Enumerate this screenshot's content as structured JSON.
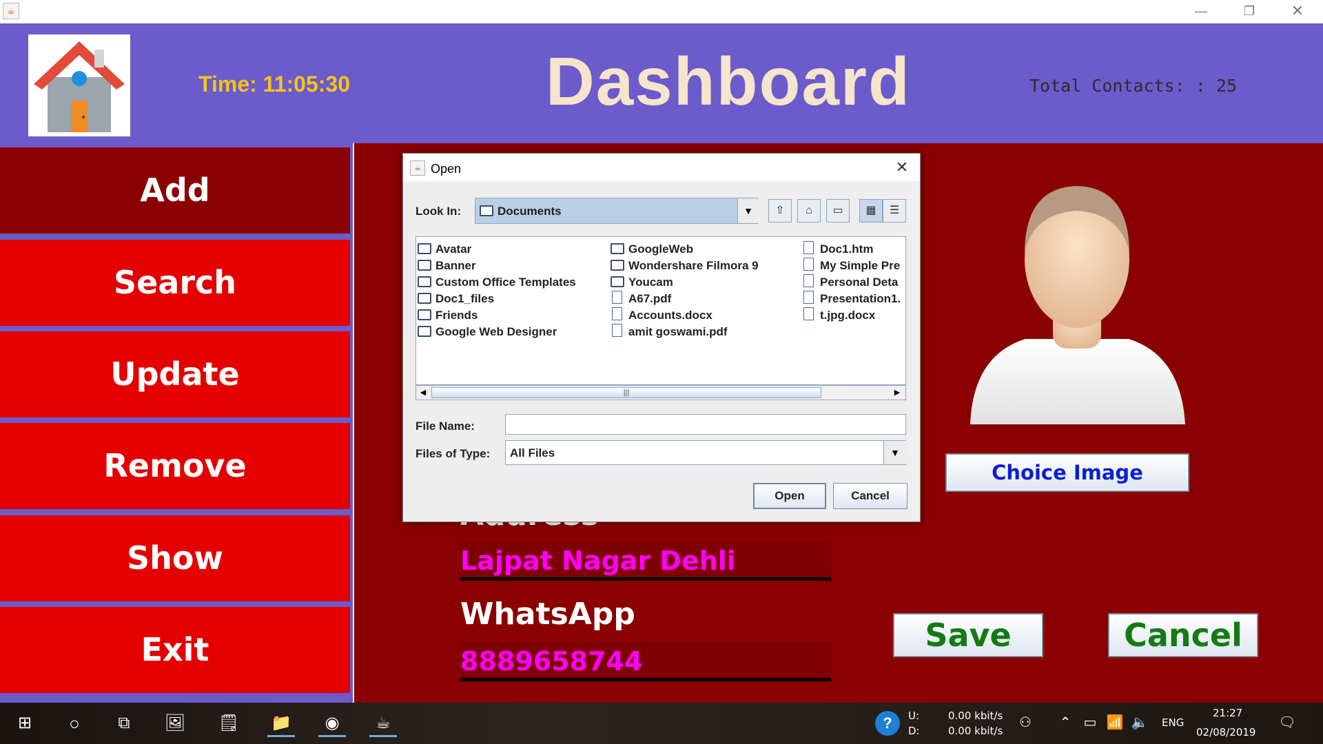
{
  "window": {
    "minimize_icon": "minimize-icon",
    "restore_icon": "restore-icon",
    "close_icon": "close-icon"
  },
  "header": {
    "time_label": "Time:  11:05:30",
    "title": "Dashboard",
    "total_contacts": "Total Contacts: : 25"
  },
  "sidebar": {
    "items": [
      {
        "label": "Add"
      },
      {
        "label": "Search"
      },
      {
        "label": "Update"
      },
      {
        "label": "Remove"
      },
      {
        "label": "Show"
      },
      {
        "label": "Exit"
      }
    ]
  },
  "form": {
    "address_label": "Address",
    "address_value": "Lajpat Nagar Dehli",
    "whatsapp_label": "WhatsApp",
    "whatsapp_value": "8889658744",
    "choice_image_label": "Choice Image",
    "save_label": "Save",
    "cancel_label": "Cancel"
  },
  "dialog": {
    "title": "Open",
    "look_in_label": "Look In:",
    "look_in_value": "Documents",
    "files_col1": [
      "Avatar",
      "Banner",
      "Custom Office Templates",
      "Doc1_files",
      "Friends",
      "Google Web Designer"
    ],
    "files_col2": [
      "GoogleWeb",
      "Wondershare Filmora 9",
      "Youcam",
      "A67.pdf",
      "Accounts.docx",
      "amit goswami.pdf"
    ],
    "files_col3": [
      "Doc1.htm",
      "My Simple Pre",
      "Personal Deta",
      "Presentation1.",
      "t.jpg.docx"
    ],
    "file_name_label": "File Name:",
    "file_name_value": "",
    "files_of_type_label": "Files of Type:",
    "files_of_type_value": "All Files",
    "open_label": "Open",
    "cancel_label": "Cancel"
  },
  "taskbar": {
    "network_u_label": "U:",
    "network_d_label": "D:",
    "upload_speed": "0.00 kbit/s",
    "download_speed": "0.00 kbit/s",
    "language": "ENG",
    "time": "21:27",
    "date": "02/08/2019"
  },
  "colors": {
    "header_bg": "#6b5bcb",
    "sidebar_button": "#e50000",
    "sidebar_active": "#8b0000",
    "main_bg": "#8b0000",
    "time_text": "#f5c518",
    "title_text": "#f6e4cb",
    "field_value": "#ff00ff",
    "choice_text": "#0b1fd1",
    "save_cancel_text": "#147a14"
  }
}
